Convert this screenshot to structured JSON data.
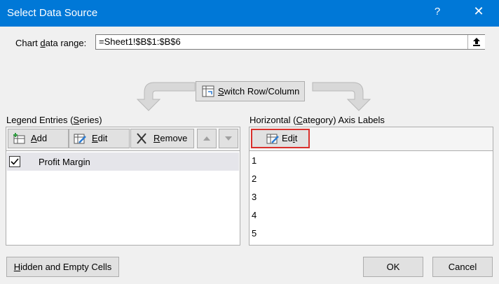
{
  "window": {
    "title": "Select Data Source",
    "help": "?",
    "close": "✕"
  },
  "range": {
    "label_pre": "Chart ",
    "label_ul": "d",
    "label_post": "ata range:",
    "value": "=Sheet1!$B$1:$B$6"
  },
  "switch_button": {
    "pre": "",
    "ul": "S",
    "post": "witch Row/Column"
  },
  "legend": {
    "header_pre": "Legend Entries (",
    "header_ul": "S",
    "header_post": "eries)",
    "add": {
      "ul": "A",
      "post": "dd"
    },
    "edit": {
      "ul": "E",
      "post": "dit"
    },
    "remove": {
      "ul": "R",
      "post": "emove"
    },
    "entries": [
      {
        "label": "Profit Margin",
        "checked": true
      }
    ]
  },
  "axis": {
    "header_pre": "Horizontal (",
    "header_ul": "C",
    "header_post": "ategory) Axis Labels",
    "edit": {
      "pre": "Ed",
      "ul": "i",
      "post": "t"
    },
    "labels": [
      "1",
      "2",
      "3",
      "4",
      "5"
    ]
  },
  "footer": {
    "hidden_cells": {
      "ul": "H",
      "post": "idden and Empty Cells"
    },
    "ok": "OK",
    "cancel": "Cancel"
  }
}
